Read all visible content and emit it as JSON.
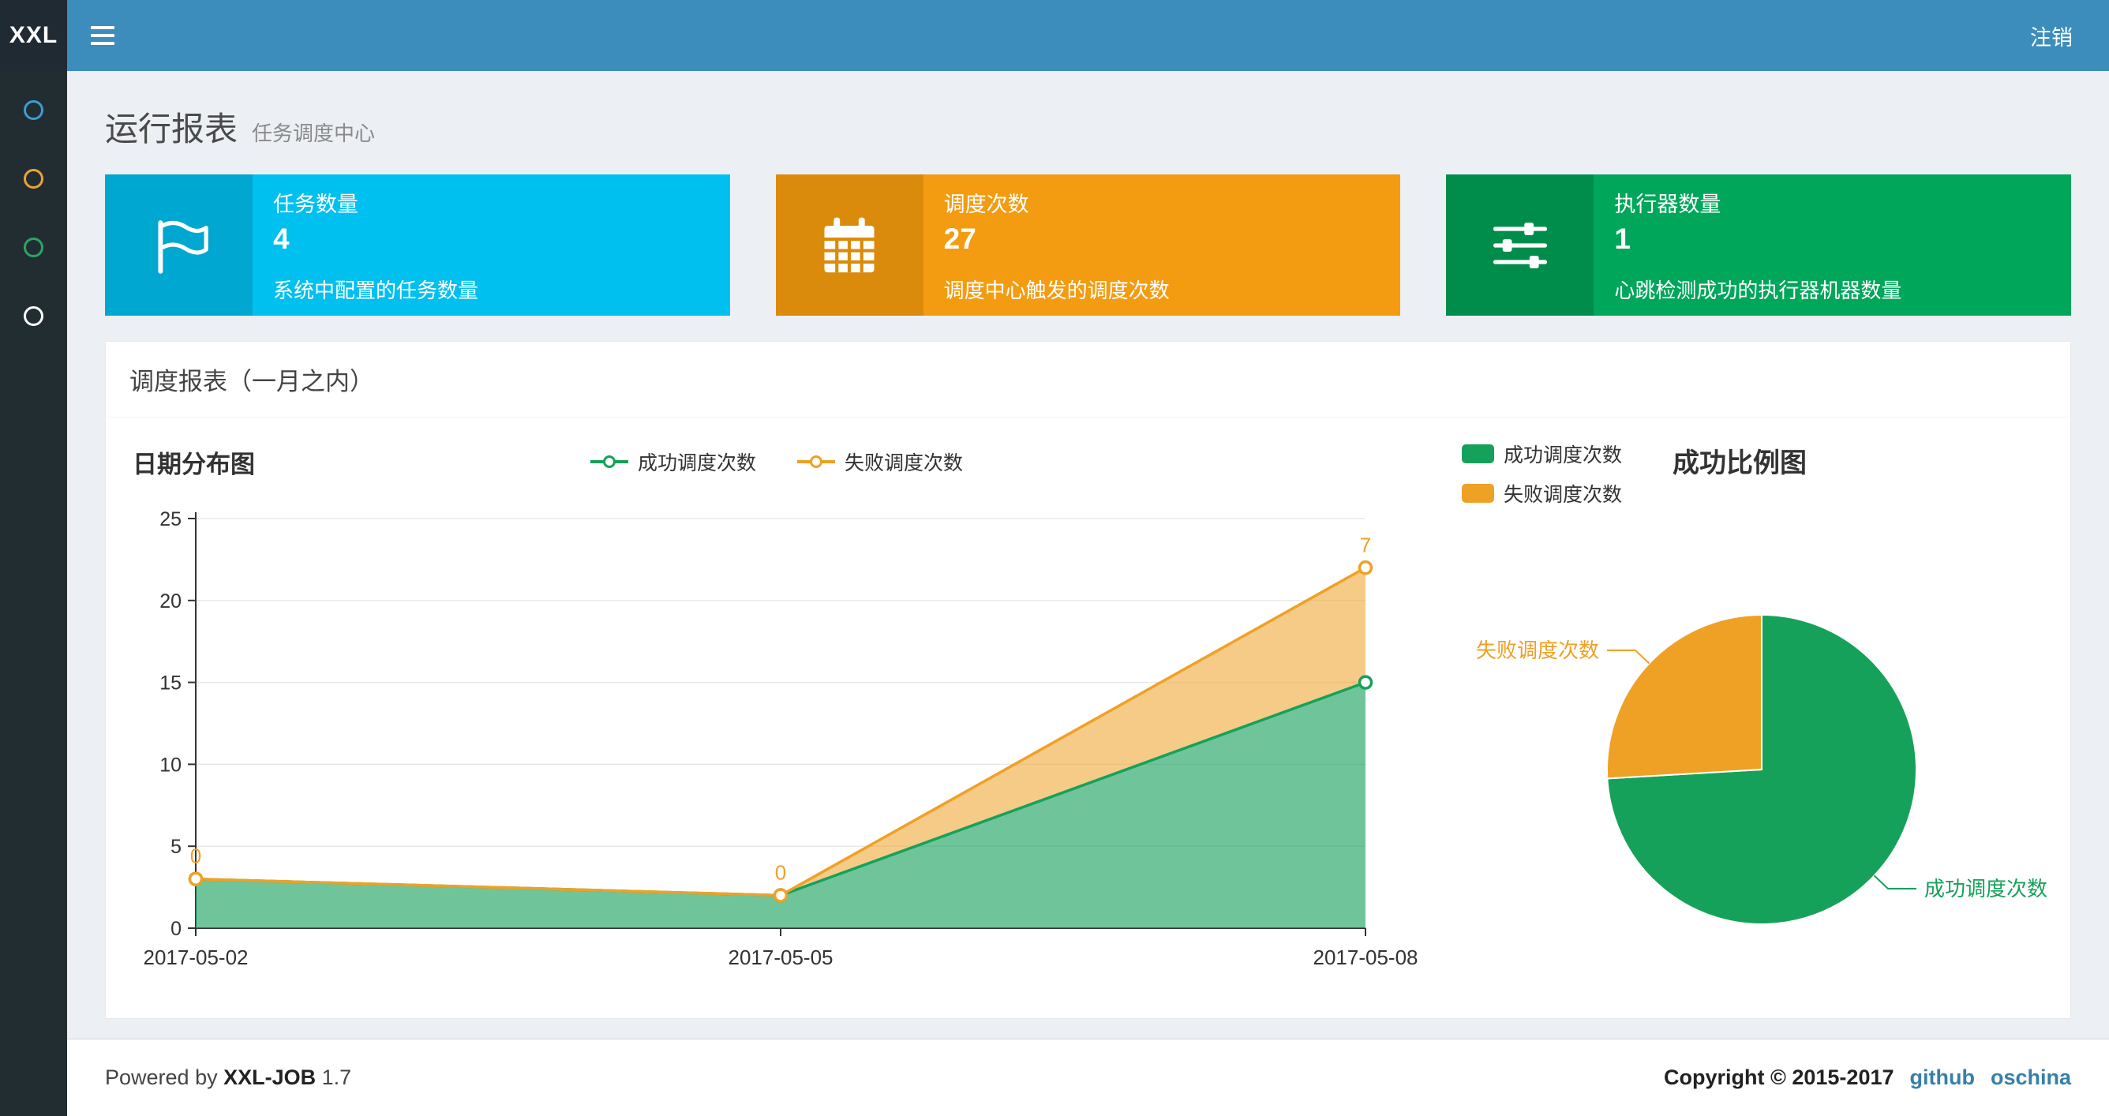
{
  "navbar": {
    "logo": "XXL",
    "logout": "注销"
  },
  "sidebar": {
    "icons": [
      "#3c9dd0",
      "#e9a33c",
      "#29a564",
      "#ffffff"
    ]
  },
  "page": {
    "title": "运行报表",
    "subtitle": "任务调度中心"
  },
  "info_boxes": [
    {
      "title": "任务数量",
      "value": "4",
      "desc": "系统中配置的任务数量",
      "bg": "#00c0ef",
      "icon_bg": "#00a7d0",
      "icon": "flag-icon"
    },
    {
      "title": "调度次数",
      "value": "27",
      "desc": "调度中心触发的调度次数",
      "bg": "#f39c12",
      "icon_bg": "#db8b0b",
      "icon": "calendar-icon"
    },
    {
      "title": "执行器数量",
      "value": "1",
      "desc": "心跳检测成功的执行器机器数量",
      "bg": "#00a65a",
      "icon_bg": "#008d4c",
      "icon": "sliders-icon"
    }
  ],
  "panel": {
    "title": "调度报表（一月之内）"
  },
  "chart_data": [
    {
      "type": "area",
      "title": "日期分布图",
      "x": [
        "2017-05-02",
        "2017-05-05",
        "2017-05-08"
      ],
      "series": [
        {
          "name": "成功调度次数",
          "values": [
            3,
            2,
            15
          ],
          "color": "#16a15a",
          "stacked": true
        },
        {
          "name": "失败调度次数",
          "values": [
            0,
            0,
            7
          ],
          "color": "#efa126",
          "stacked": true,
          "point_labels": [
            "0",
            "0",
            "7"
          ]
        }
      ],
      "ylim": [
        0,
        25
      ],
      "yticks": [
        0,
        5,
        10,
        15,
        20,
        25
      ],
      "grid": true,
      "legend_position": "top-center"
    },
    {
      "type": "pie",
      "title": "成功比例图",
      "slices": [
        {
          "name": "成功调度次数",
          "value": 20,
          "color": "#16a15a"
        },
        {
          "name": "失败调度次数",
          "value": 7,
          "color": "#efa126"
        }
      ],
      "legend_position": "top-left"
    }
  ],
  "footer": {
    "powered": "Powered by",
    "product": "XXL-JOB",
    "version": "1.7",
    "copyright": "Copyright © 2015-2017",
    "link1": "github",
    "link2": "oschina"
  }
}
